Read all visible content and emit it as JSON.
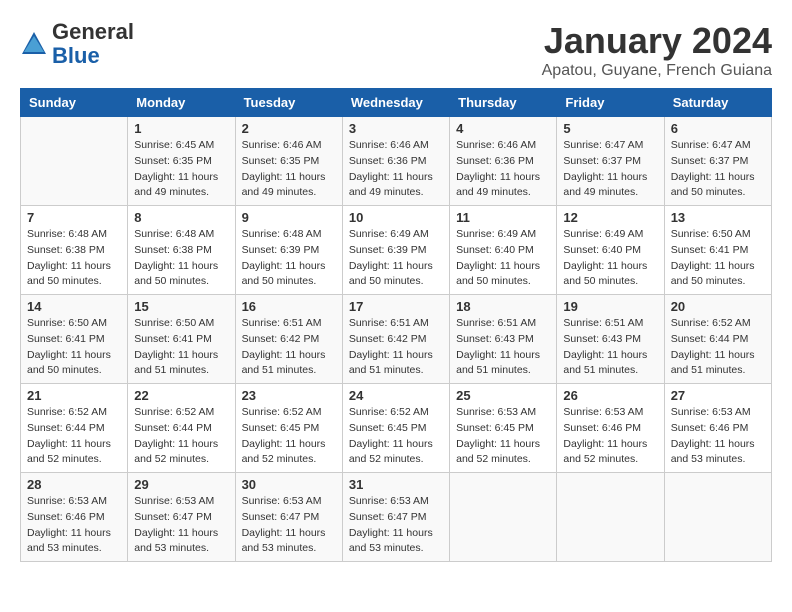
{
  "header": {
    "logo_general": "General",
    "logo_blue": "Blue",
    "month_title": "January 2024",
    "location": "Apatou, Guyane, French Guiana"
  },
  "days_of_week": [
    "Sunday",
    "Monday",
    "Tuesday",
    "Wednesday",
    "Thursday",
    "Friday",
    "Saturday"
  ],
  "weeks": [
    [
      {
        "day": "",
        "info": ""
      },
      {
        "day": "1",
        "info": "Sunrise: 6:45 AM\nSunset: 6:35 PM\nDaylight: 11 hours\nand 49 minutes."
      },
      {
        "day": "2",
        "info": "Sunrise: 6:46 AM\nSunset: 6:35 PM\nDaylight: 11 hours\nand 49 minutes."
      },
      {
        "day": "3",
        "info": "Sunrise: 6:46 AM\nSunset: 6:36 PM\nDaylight: 11 hours\nand 49 minutes."
      },
      {
        "day": "4",
        "info": "Sunrise: 6:46 AM\nSunset: 6:36 PM\nDaylight: 11 hours\nand 49 minutes."
      },
      {
        "day": "5",
        "info": "Sunrise: 6:47 AM\nSunset: 6:37 PM\nDaylight: 11 hours\nand 49 minutes."
      },
      {
        "day": "6",
        "info": "Sunrise: 6:47 AM\nSunset: 6:37 PM\nDaylight: 11 hours\nand 50 minutes."
      }
    ],
    [
      {
        "day": "7",
        "info": "Sunrise: 6:48 AM\nSunset: 6:38 PM\nDaylight: 11 hours\nand 50 minutes."
      },
      {
        "day": "8",
        "info": "Sunrise: 6:48 AM\nSunset: 6:38 PM\nDaylight: 11 hours\nand 50 minutes."
      },
      {
        "day": "9",
        "info": "Sunrise: 6:48 AM\nSunset: 6:39 PM\nDaylight: 11 hours\nand 50 minutes."
      },
      {
        "day": "10",
        "info": "Sunrise: 6:49 AM\nSunset: 6:39 PM\nDaylight: 11 hours\nand 50 minutes."
      },
      {
        "day": "11",
        "info": "Sunrise: 6:49 AM\nSunset: 6:40 PM\nDaylight: 11 hours\nand 50 minutes."
      },
      {
        "day": "12",
        "info": "Sunrise: 6:49 AM\nSunset: 6:40 PM\nDaylight: 11 hours\nand 50 minutes."
      },
      {
        "day": "13",
        "info": "Sunrise: 6:50 AM\nSunset: 6:41 PM\nDaylight: 11 hours\nand 50 minutes."
      }
    ],
    [
      {
        "day": "14",
        "info": "Sunrise: 6:50 AM\nSunset: 6:41 PM\nDaylight: 11 hours\nand 50 minutes."
      },
      {
        "day": "15",
        "info": "Sunrise: 6:50 AM\nSunset: 6:41 PM\nDaylight: 11 hours\nand 51 minutes."
      },
      {
        "day": "16",
        "info": "Sunrise: 6:51 AM\nSunset: 6:42 PM\nDaylight: 11 hours\nand 51 minutes."
      },
      {
        "day": "17",
        "info": "Sunrise: 6:51 AM\nSunset: 6:42 PM\nDaylight: 11 hours\nand 51 minutes."
      },
      {
        "day": "18",
        "info": "Sunrise: 6:51 AM\nSunset: 6:43 PM\nDaylight: 11 hours\nand 51 minutes."
      },
      {
        "day": "19",
        "info": "Sunrise: 6:51 AM\nSunset: 6:43 PM\nDaylight: 11 hours\nand 51 minutes."
      },
      {
        "day": "20",
        "info": "Sunrise: 6:52 AM\nSunset: 6:44 PM\nDaylight: 11 hours\nand 51 minutes."
      }
    ],
    [
      {
        "day": "21",
        "info": "Sunrise: 6:52 AM\nSunset: 6:44 PM\nDaylight: 11 hours\nand 52 minutes."
      },
      {
        "day": "22",
        "info": "Sunrise: 6:52 AM\nSunset: 6:44 PM\nDaylight: 11 hours\nand 52 minutes."
      },
      {
        "day": "23",
        "info": "Sunrise: 6:52 AM\nSunset: 6:45 PM\nDaylight: 11 hours\nand 52 minutes."
      },
      {
        "day": "24",
        "info": "Sunrise: 6:52 AM\nSunset: 6:45 PM\nDaylight: 11 hours\nand 52 minutes."
      },
      {
        "day": "25",
        "info": "Sunrise: 6:53 AM\nSunset: 6:45 PM\nDaylight: 11 hours\nand 52 minutes."
      },
      {
        "day": "26",
        "info": "Sunrise: 6:53 AM\nSunset: 6:46 PM\nDaylight: 11 hours\nand 52 minutes."
      },
      {
        "day": "27",
        "info": "Sunrise: 6:53 AM\nSunset: 6:46 PM\nDaylight: 11 hours\nand 53 minutes."
      }
    ],
    [
      {
        "day": "28",
        "info": "Sunrise: 6:53 AM\nSunset: 6:46 PM\nDaylight: 11 hours\nand 53 minutes."
      },
      {
        "day": "29",
        "info": "Sunrise: 6:53 AM\nSunset: 6:47 PM\nDaylight: 11 hours\nand 53 minutes."
      },
      {
        "day": "30",
        "info": "Sunrise: 6:53 AM\nSunset: 6:47 PM\nDaylight: 11 hours\nand 53 minutes."
      },
      {
        "day": "31",
        "info": "Sunrise: 6:53 AM\nSunset: 6:47 PM\nDaylight: 11 hours\nand 53 minutes."
      },
      {
        "day": "",
        "info": ""
      },
      {
        "day": "",
        "info": ""
      },
      {
        "day": "",
        "info": ""
      }
    ]
  ]
}
